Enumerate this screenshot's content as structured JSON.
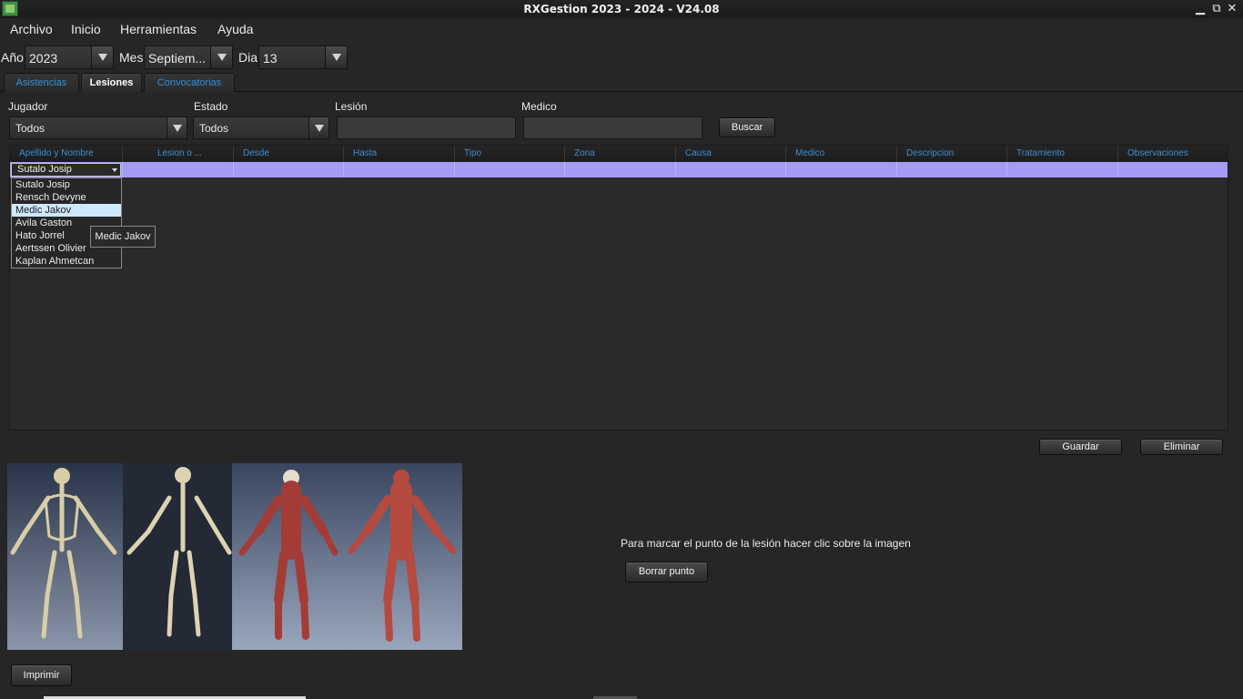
{
  "window": {
    "title": "RXGestion 2023 - 2024 - V24.08",
    "minimize": "▁",
    "restore": "⧉",
    "close": "✕"
  },
  "menu": {
    "file": "Archivo",
    "home": "Inicio",
    "tools": "Herramientas",
    "help": "Ayuda"
  },
  "date": {
    "year_label": "Año",
    "year_value": "2023",
    "month_label": "Mes",
    "month_value": "Septiem...",
    "day_label": "Dia",
    "day_value": "13"
  },
  "tabs": [
    {
      "label": "Asistencias",
      "active": false
    },
    {
      "label": "Lesiones",
      "active": true
    },
    {
      "label": "Convocatorias",
      "active": false
    }
  ],
  "filters": {
    "player_label": "Jugador",
    "player_value": "Todos",
    "state_label": "Estado",
    "state_value": "Todos",
    "injury_label": "Lesión",
    "injury_value": "",
    "doctor_label": "Medico",
    "doctor_value": "",
    "search_button": "Buscar"
  },
  "grid": {
    "columns": [
      "Apellido y Nombre",
      "Lesion o ...",
      "Desde",
      "Hasta",
      "Tipo",
      "Zona",
      "Causa",
      "Medico",
      "Descripcion",
      "Tratamiento",
      "Observaciones"
    ],
    "selected_cell_value": "Sutalo Josip"
  },
  "player_dropdown": {
    "options": [
      "Sutalo Josip",
      "Rensch Devyne",
      "Medic Jakov",
      "Avila Gaston",
      "Hato Jorrel",
      "Aertssen Olivier",
      "Kaplan Ahmetcan"
    ],
    "highlighted": "Medic Jakov",
    "tooltip": "Medic Jakov"
  },
  "actions": {
    "save": "Guardar",
    "delete": "Eliminar",
    "clear_point": "Borrar punto",
    "print": "Imprimir"
  },
  "hint": "Para marcar el punto de la lesión hacer clic sobre la imagen",
  "colors": {
    "background": "#262626",
    "header_text": "#3a8fd4",
    "row_selected": "#a49cf4",
    "dropdown_highlight": "#cde8ff"
  },
  "icons": {
    "app": "app-icon",
    "dropdown": "chevron-down-icon"
  }
}
